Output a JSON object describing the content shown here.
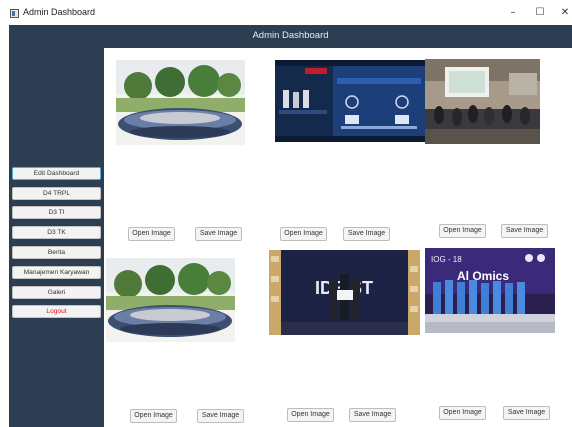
{
  "window": {
    "title": "Admin Dashboard",
    "min": "–",
    "max": "☐",
    "close": "✕"
  },
  "header": {
    "title": "Admin Dashboard"
  },
  "sidebar": {
    "items": [
      {
        "label": "Edit Dashboard"
      },
      {
        "label": "D4 TRPL"
      },
      {
        "label": "D3 TI"
      },
      {
        "label": "D3 TK"
      },
      {
        "label": "Berita"
      },
      {
        "label": "Manajemen Karyawan"
      },
      {
        "label": "Galeri"
      },
      {
        "label": "Logout"
      }
    ]
  },
  "gallery": {
    "open_label": "Open Image",
    "save_label": "Save Image",
    "photos": [
      {
        "name": "group-photo-outdoor"
      },
      {
        "name": "event-presentation-screen"
      },
      {
        "name": "hall-audience"
      },
      {
        "name": "group-photo-outdoor-2"
      },
      {
        "name": "ideafest-stage"
      },
      {
        "name": "team-booth-photo"
      }
    ]
  },
  "colors": {
    "navy": "#2e3e52",
    "logout": "#d11a1a",
    "active_border": "#5aa8df"
  }
}
